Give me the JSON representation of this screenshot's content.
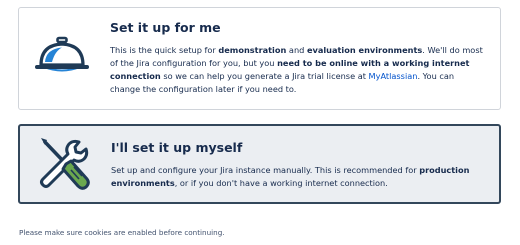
{
  "options": {
    "auto": {
      "title": "Set it up for me",
      "icon": "cloche-serving-dish-icon",
      "desc": {
        "t1": "This is the quick setup for ",
        "b1": "demonstration",
        "t2": " and ",
        "b2": "evaluation environments",
        "t3": ". We'll do most of the Jira configuration for you, but you ",
        "b3": "need to be online with a working internet connection",
        "t4": " so we can help you generate a Jira trial license at ",
        "link": "MyAtlassian",
        "t5": ". You can change the configuration later if you need to."
      }
    },
    "manual": {
      "title": "I'll set it up myself",
      "icon": "wrench-screwdriver-icon",
      "selected": true,
      "desc": {
        "t1": "Set up and configure your Jira instance manually. This is recommended for ",
        "b1": "production environments",
        "t2": ", or if you don't have a working internet connection."
      }
    }
  },
  "footer": {
    "note": "Please make sure cookies are enabled before continuing."
  },
  "colors": {
    "text": "#172b4d",
    "link": "#0052cc",
    "selected_border": "#33475b",
    "selected_bg": "#ebeef2",
    "icon_dark": "#1f3a56",
    "icon_blue": "#2684d6",
    "icon_green": "#6aa84f"
  }
}
